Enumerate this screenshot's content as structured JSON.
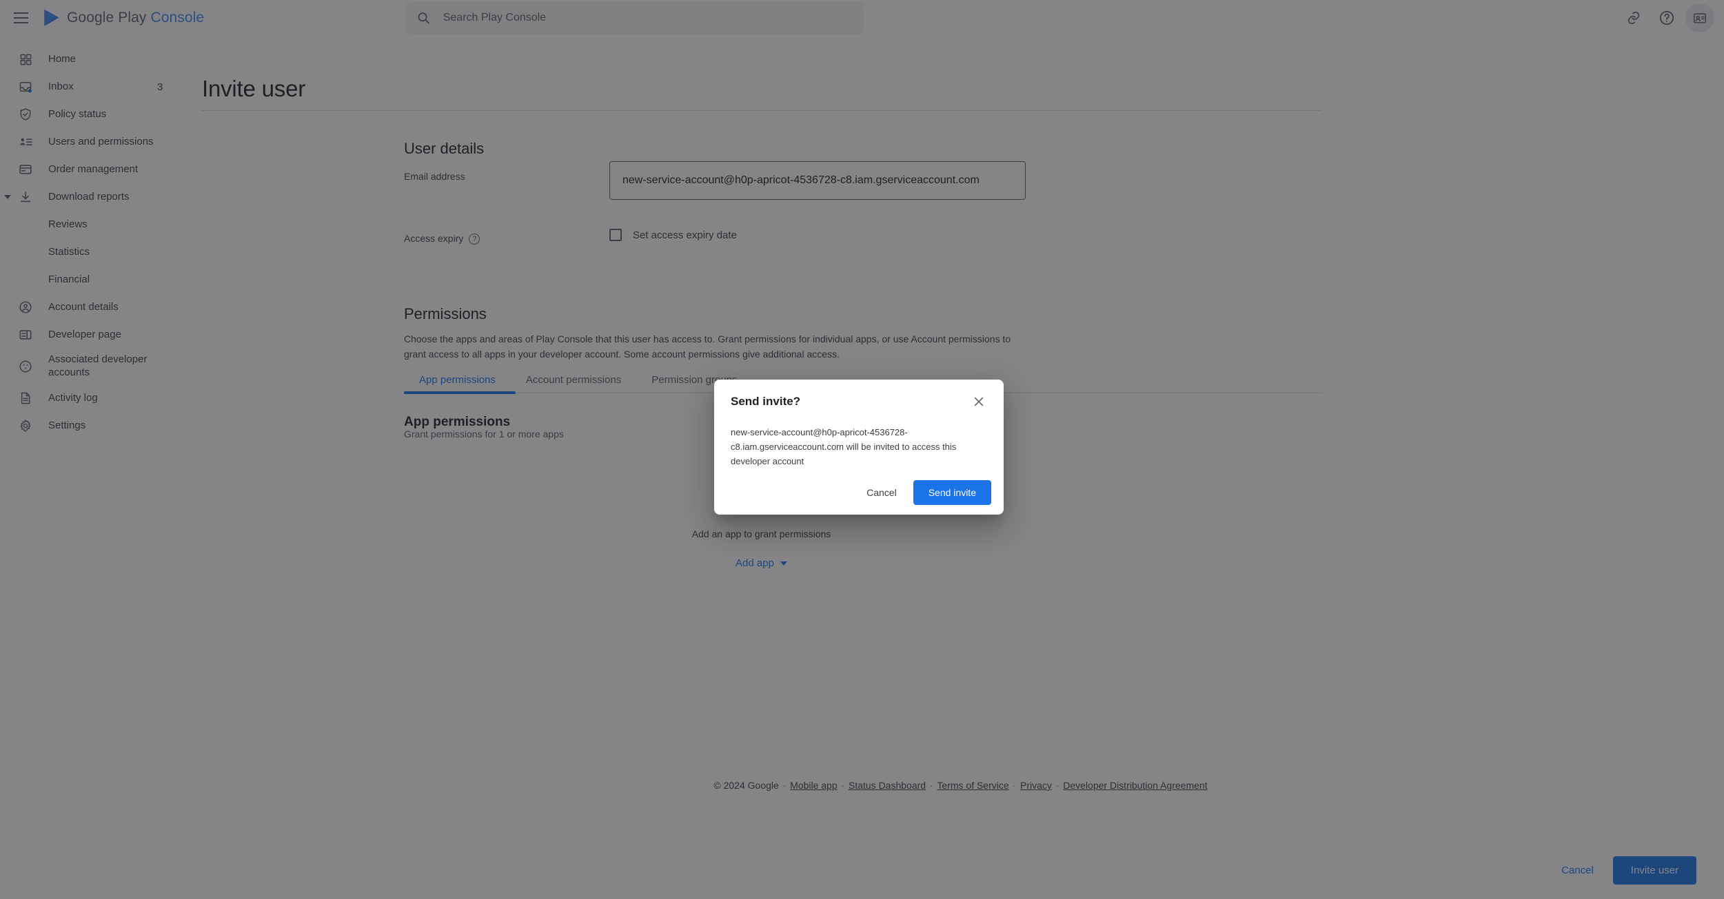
{
  "app": {
    "brand_google_play": "Google Play",
    "brand_console": " Console",
    "accent_blue": "#1a73e8",
    "logo_blue": "#4285f4"
  },
  "topbar": {
    "menu_icon": "hamburger-menu-icon",
    "search_placeholder": "Search Play Console",
    "search_value": "",
    "icons": [
      {
        "name": "link-icon",
        "label": "Link"
      },
      {
        "name": "help-icon",
        "label": "Help"
      },
      {
        "name": "account-badge-icon",
        "label": "Account"
      }
    ]
  },
  "sidebar": {
    "items": [
      {
        "label": "Home",
        "icon": "grid-icon",
        "badge": "",
        "indented": false,
        "expander": false
      },
      {
        "label": "Inbox",
        "icon": "inbox-icon",
        "badge": "3",
        "indented": false,
        "expander": false
      },
      {
        "label": "Policy status",
        "icon": "shield-check-icon",
        "badge": "",
        "indented": false,
        "expander": false
      },
      {
        "label": "Users and permissions",
        "icon": "person-list-icon",
        "badge": "",
        "indented": false,
        "expander": false
      },
      {
        "label": "Order management",
        "icon": "credit-card-icon",
        "badge": "",
        "indented": false,
        "expander": false
      },
      {
        "label": "Download reports",
        "icon": "download-icon",
        "badge": "",
        "indented": false,
        "expander": true
      },
      {
        "label": "Reviews",
        "icon": "",
        "badge": "",
        "indented": true,
        "expander": false
      },
      {
        "label": "Statistics",
        "icon": "",
        "badge": "",
        "indented": true,
        "expander": false
      },
      {
        "label": "Financial",
        "icon": "",
        "badge": "",
        "indented": true,
        "expander": false
      },
      {
        "label": "Account details",
        "icon": "account-circle-icon",
        "badge": "",
        "indented": false,
        "expander": false
      },
      {
        "label": "Developer page",
        "icon": "layout-icon",
        "badge": "",
        "indented": false,
        "expander": false
      },
      {
        "label": "Associated developer accounts",
        "icon": "group-circle-icon",
        "badge": "",
        "indented": false,
        "expander": false
      },
      {
        "label": "Activity log",
        "icon": "document-icon",
        "badge": "",
        "indented": false,
        "expander": false
      },
      {
        "label": "Settings",
        "icon": "gear-icon",
        "badge": "",
        "indented": false,
        "expander": false
      }
    ]
  },
  "main": {
    "breadcrumb": "Users and permissions",
    "page_title": "Invite user",
    "user_details": {
      "heading": "User details",
      "email_label": "Email address",
      "email_value": "new-service-account@h0p-apricot-4536728-c8.iam.gserviceaccount.com",
      "email_placeholder": "Email address",
      "access_expiry_label": "Access expiry",
      "access_expiry_checkbox_label": "Set access expiry date",
      "access_expiry_checked": false
    },
    "permissions": {
      "heading": "Permissions",
      "description": "Choose the apps and areas of Play Console that this user has access to. Grant permissions for individual apps, or use Account permissions to grant access to all apps in your developer account. Some account permissions give additional access.",
      "tabs": [
        {
          "label": "App permissions",
          "active": true
        },
        {
          "label": "Account permissions",
          "active": false
        },
        {
          "label": "Permission groups",
          "active": false
        }
      ],
      "subheading": "App permissions",
      "subdescription": "Grant permissions for 1 or more apps",
      "empty_state_text": "Add an app to grant permissions",
      "add_app_label": "Add app"
    }
  },
  "footer": {
    "copyright": "© 2024 Google",
    "links": [
      "Mobile app",
      "Status Dashboard",
      "Terms of Service",
      "Privacy",
      "Developer Distribution Agreement"
    ]
  },
  "actionbar": {
    "cancel_label": "Cancel",
    "invite_label": "Invite user"
  },
  "dialog": {
    "title": "Send invite?",
    "body": "new-service-account@h0p-apricot-4536728-c8.iam.gserviceaccount.com will be invited to access this developer account",
    "cancel_label": "Cancel",
    "confirm_label": "Send invite",
    "close_icon": "close-icon",
    "visible": true
  }
}
